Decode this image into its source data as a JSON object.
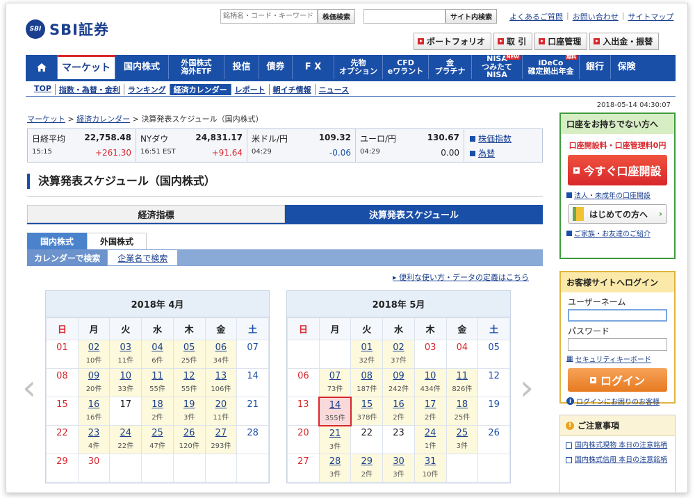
{
  "header": {
    "logo_mark": "SBI",
    "logo_text": "SBI証券",
    "search_placeholder": "銘柄名・コード・キーワード",
    "stock_search_btn": "株価検索",
    "site_search_btn": "サイト内検索",
    "links": [
      "よくあるご質問",
      "お問い合わせ",
      "サイトマップ"
    ],
    "quick": [
      "ポートフォリオ",
      "取 引",
      "口座管理",
      "入出金・振替"
    ]
  },
  "nav": {
    "items": [
      {
        "label": "",
        "icon": "home-icon"
      },
      {
        "label": "マーケット",
        "active": true
      },
      {
        "label": "国内株式"
      },
      {
        "label": "外国株式\n海外ETF"
      },
      {
        "label": "投信"
      },
      {
        "label": "債券"
      },
      {
        "label": "F X"
      },
      {
        "label": "先物\nオプション"
      },
      {
        "label": "CFD\neワラント"
      },
      {
        "label": "金\nプラチナ"
      },
      {
        "label": "NISA\nつみたてNISA",
        "badge": "NEW"
      },
      {
        "label": "iDeCo\n確定拠出年金",
        "badge": "無料"
      },
      {
        "label": "銀行"
      },
      {
        "label": "保険"
      }
    ],
    "subnav": [
      "TOP",
      "指数・為替・金利",
      "ランキング",
      "経済カレンダー",
      "レポート",
      "朝イチ情報",
      "ニュース"
    ],
    "subnav_active": "経済カレンダー"
  },
  "datestamp": "2018-05-14 04:30:07",
  "breadcrumb": [
    "マーケット",
    "経済カレンダー",
    "決算発表スケジュール（国内株式）"
  ],
  "ticker": [
    {
      "name": "日経平均",
      "value": "22,758.48",
      "time": "15:15",
      "change": "+261.30",
      "dir": "up"
    },
    {
      "name": "NYダウ",
      "value": "24,831.17",
      "time": "16:51 EST",
      "change": "+91.64",
      "dir": "up"
    },
    {
      "name": "米ドル/円",
      "value": "109.32",
      "time": "04:29",
      "change": "-0.06",
      "dir": "dn"
    },
    {
      "name": "ユーロ/円",
      "value": "130.67",
      "time": "04:29",
      "change": "0.00",
      "dir": "flat"
    }
  ],
  "ticker_links": [
    "株価指数",
    "為替"
  ],
  "page_title": "決算発表スケジュール（国内株式）",
  "big_tabs": [
    "経済指標",
    "決算発表スケジュール"
  ],
  "small_tabs": [
    "国内株式",
    "外国株式"
  ],
  "search_bar": [
    "カレンダーで検索",
    "企業名で検索"
  ],
  "help_link": "便利な使い方・データの定義はこちら",
  "weekdays": [
    "日",
    "月",
    "火",
    "水",
    "木",
    "金",
    "土"
  ],
  "calendars": [
    {
      "title": "2018年 4月",
      "weeks": [
        [
          {
            "d": "01",
            "t": "sun"
          },
          {
            "d": "02",
            "n": "10件"
          },
          {
            "d": "03",
            "n": "11件"
          },
          {
            "d": "04",
            "n": "6件"
          },
          {
            "d": "05",
            "n": "25件"
          },
          {
            "d": "06",
            "n": "34件"
          },
          {
            "d": "07",
            "t": "sat"
          }
        ],
        [
          {
            "d": "08",
            "t": "sun"
          },
          {
            "d": "09",
            "n": "20件"
          },
          {
            "d": "10",
            "n": "33件"
          },
          {
            "d": "11",
            "n": "55件"
          },
          {
            "d": "12",
            "n": "55件"
          },
          {
            "d": "13",
            "n": "106件"
          },
          {
            "d": "14",
            "t": "sat"
          }
        ],
        [
          {
            "d": "15",
            "t": "sun"
          },
          {
            "d": "16",
            "n": "16件"
          },
          {
            "d": "17",
            "t": "empty"
          },
          {
            "d": "18",
            "n": "2件"
          },
          {
            "d": "19",
            "n": "3件"
          },
          {
            "d": "20",
            "n": "11件"
          },
          {
            "d": "21",
            "t": "sat"
          }
        ],
        [
          {
            "d": "22",
            "t": "sun"
          },
          {
            "d": "23",
            "n": "4件"
          },
          {
            "d": "24",
            "n": "22件"
          },
          {
            "d": "25",
            "n": "47件"
          },
          {
            "d": "26",
            "n": "120件"
          },
          {
            "d": "27",
            "n": "293件"
          },
          {
            "d": "28",
            "t": "sat"
          }
        ],
        [
          {
            "d": "29",
            "t": "sun"
          },
          {
            "d": "30",
            "t": "hol"
          },
          {
            "d": "",
            "t": "blank"
          },
          {
            "d": "",
            "t": "blank"
          },
          {
            "d": "",
            "t": "blank"
          },
          {
            "d": "",
            "t": "blank"
          },
          {
            "d": "",
            "t": "blank"
          }
        ]
      ]
    },
    {
      "title": "2018年 5月",
      "weeks": [
        [
          {
            "d": "",
            "t": "blank"
          },
          {
            "d": "",
            "t": "blank"
          },
          {
            "d": "01",
            "n": "32件"
          },
          {
            "d": "02",
            "n": "37件"
          },
          {
            "d": "03",
            "t": "hol"
          },
          {
            "d": "04",
            "t": "hol"
          },
          {
            "d": "05",
            "t": "sat"
          }
        ],
        [
          {
            "d": "06",
            "t": "sun"
          },
          {
            "d": "07",
            "n": "73件"
          },
          {
            "d": "08",
            "n": "187件"
          },
          {
            "d": "09",
            "n": "242件"
          },
          {
            "d": "10",
            "n": "434件"
          },
          {
            "d": "11",
            "n": "826件"
          },
          {
            "d": "12",
            "t": "sat"
          }
        ],
        [
          {
            "d": "13",
            "t": "sun"
          },
          {
            "d": "14",
            "n": "355件",
            "today": true
          },
          {
            "d": "15",
            "n": "378件"
          },
          {
            "d": "16",
            "n": "2件"
          },
          {
            "d": "17",
            "n": "2件"
          },
          {
            "d": "18",
            "n": "25件"
          },
          {
            "d": "19",
            "t": "sat"
          }
        ],
        [
          {
            "d": "20",
            "t": "sun"
          },
          {
            "d": "21",
            "n": "3件"
          },
          {
            "d": "22",
            "t": "empty"
          },
          {
            "d": "23",
            "t": "empty"
          },
          {
            "d": "24",
            "n": "1件"
          },
          {
            "d": "25",
            "n": "3件"
          },
          {
            "d": "26",
            "t": "sat"
          }
        ],
        [
          {
            "d": "27",
            "t": "sun"
          },
          {
            "d": "28",
            "n": "3件"
          },
          {
            "d": "29",
            "n": "2件"
          },
          {
            "d": "30",
            "n": "3件"
          },
          {
            "d": "31",
            "n": "10件"
          },
          {
            "d": "",
            "t": "blank"
          },
          {
            "d": "",
            "t": "blank"
          }
        ]
      ]
    }
  ],
  "sidebar": {
    "account_head": "口座をお持ちでない方へ",
    "account_free": "口座開設料・口座管理料0円",
    "open_btn": "今すぐ口座開設",
    "corp_link": "法人・未成年の口座開設",
    "beginner_btn": "はじめての方へ",
    "family_link": "ご家族・お友達のご紹介",
    "login_head": "お客様サイトへログイン",
    "username_label": "ユーザーネーム",
    "password_label": "パスワード",
    "keyboard_link": "セキュリティキーボード",
    "login_btn": "ログイン",
    "login_help": "ログインにお困りのお客様",
    "notice_head": "ご注意事項",
    "notices": [
      "国内株式現物 本日の注意銘柄",
      "国内株式信用 本日の注意銘柄"
    ]
  },
  "colors": {
    "brand": "#1a4fa8",
    "accent_red": "#d8262b",
    "green": "#3c9b3c",
    "orange": "#e77a20"
  }
}
